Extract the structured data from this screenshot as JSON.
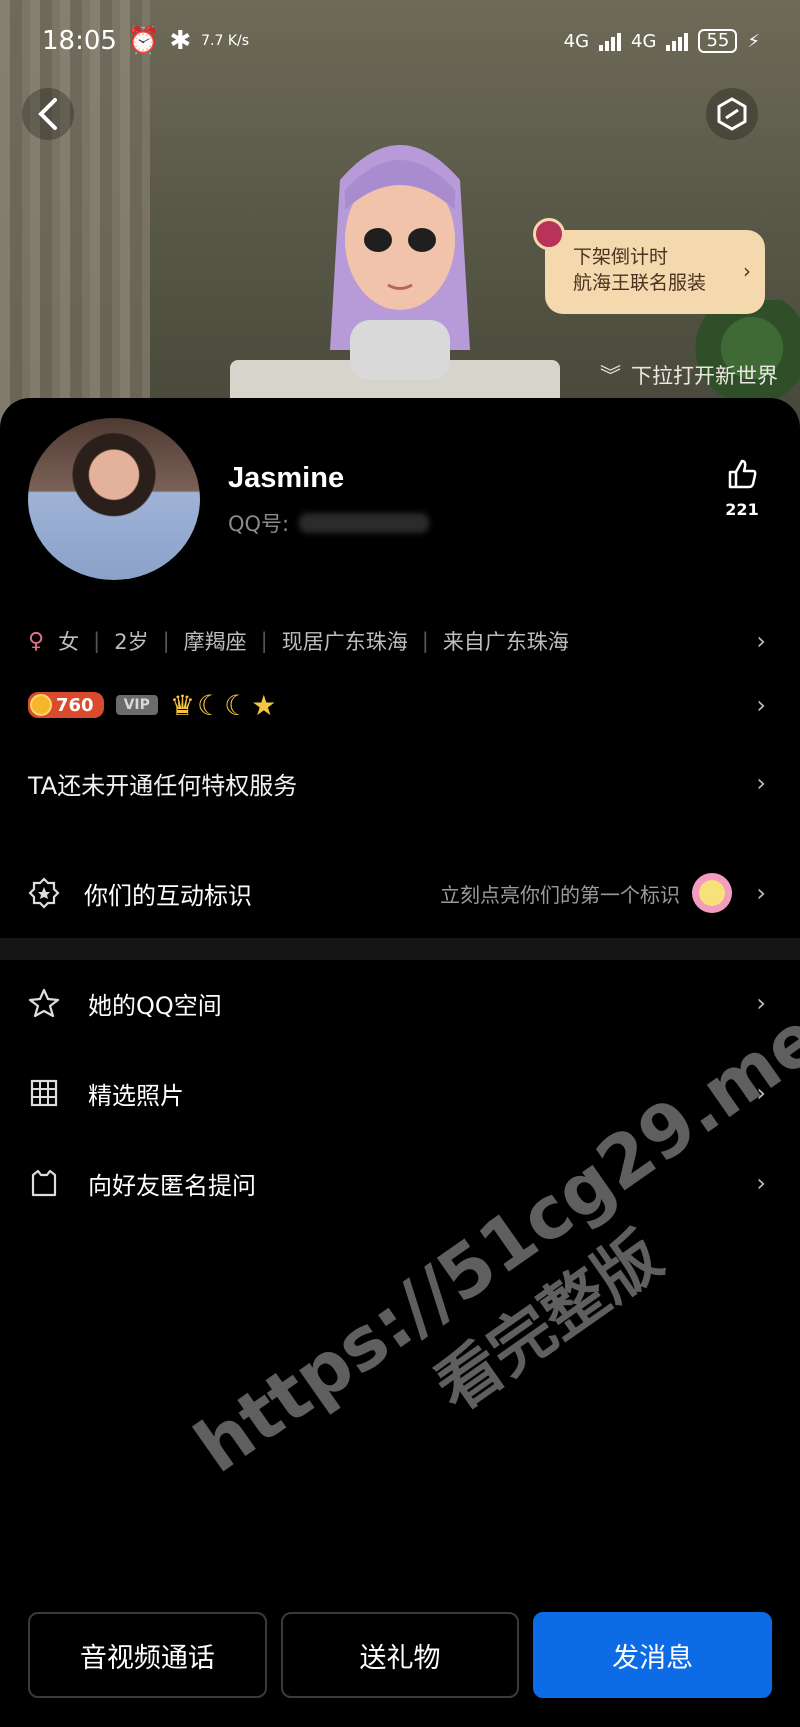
{
  "status_bar": {
    "time": "18:05",
    "net_speed": "7.7 K/s",
    "net1": "4G",
    "net2": "4G",
    "battery": "55"
  },
  "hero": {
    "promo_line1": "下架倒计时",
    "promo_line2": "航海王联名服装",
    "pull_hint": "下拉打开新世界"
  },
  "profile": {
    "name": "Jasmine",
    "qq_label": "QQ号:",
    "likes": "221"
  },
  "info": {
    "gender": "女",
    "age": "2岁",
    "zodiac": "摩羯座",
    "location": "现居广东珠海",
    "hometown": "来自广东珠海"
  },
  "badges": {
    "coin_value": "760",
    "vip_label": "VIP"
  },
  "privilege": {
    "text": "TA还未开通任何特权服务"
  },
  "interaction": {
    "label": "你们的互动标识",
    "hint": "立刻点亮你们的第一个标识"
  },
  "menu": [
    {
      "label": "她的QQ空间",
      "icon": "star-icon"
    },
    {
      "label": "精选照片",
      "icon": "grid-icon"
    },
    {
      "label": "向好友匿名提问",
      "icon": "cat-bag-icon"
    }
  ],
  "actions": {
    "call": "音视频通话",
    "gift": "送礼物",
    "message": "发消息"
  },
  "watermark": {
    "line1": "https://51cg29.me",
    "line2": "看完整版"
  }
}
